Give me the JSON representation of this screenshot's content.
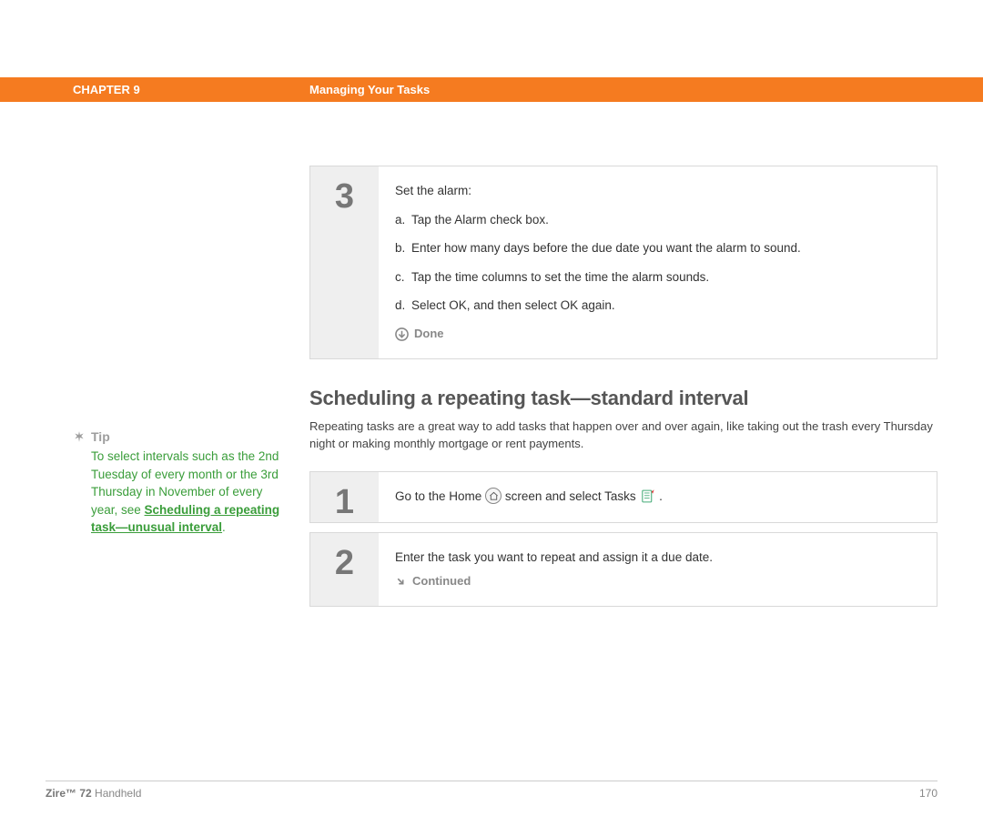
{
  "header": {
    "chapter": "CHAPTER 9",
    "title": "Managing Your Tasks"
  },
  "step3": {
    "number": "3",
    "lead": "Set the alarm:",
    "items": [
      {
        "label": "a.",
        "text": "Tap the Alarm check box."
      },
      {
        "label": "b.",
        "text": "Enter how many days before the due date you want the alarm to sound."
      },
      {
        "label": "c.",
        "text": "Tap the time columns to set the time the alarm sounds."
      },
      {
        "label": "d.",
        "text": "Select OK, and then select OK again."
      }
    ],
    "done": "Done"
  },
  "section": {
    "title": "Scheduling a repeating task—standard interval",
    "intro": "Repeating tasks are a great way to add tasks that happen over and over again, like taking out the trash every Thursday night or making monthly mortgage or rent payments."
  },
  "tip": {
    "label": "Tip",
    "body_pre": "To select intervals such as the 2nd Tuesday of every month or the 3rd Thursday in November of every year, see ",
    "link": "Scheduling a repeating task—unusual interval",
    "body_post": "."
  },
  "step1": {
    "number": "1",
    "pre": "Go to the Home ",
    "mid": " screen and select Tasks ",
    "post": " ."
  },
  "step2": {
    "number": "2",
    "text": "Enter the task you want to repeat and assign it a due date.",
    "continued": "Continued"
  },
  "footer": {
    "product_bold": "Zire™ 72",
    "product_rest": " Handheld",
    "page": "170"
  }
}
